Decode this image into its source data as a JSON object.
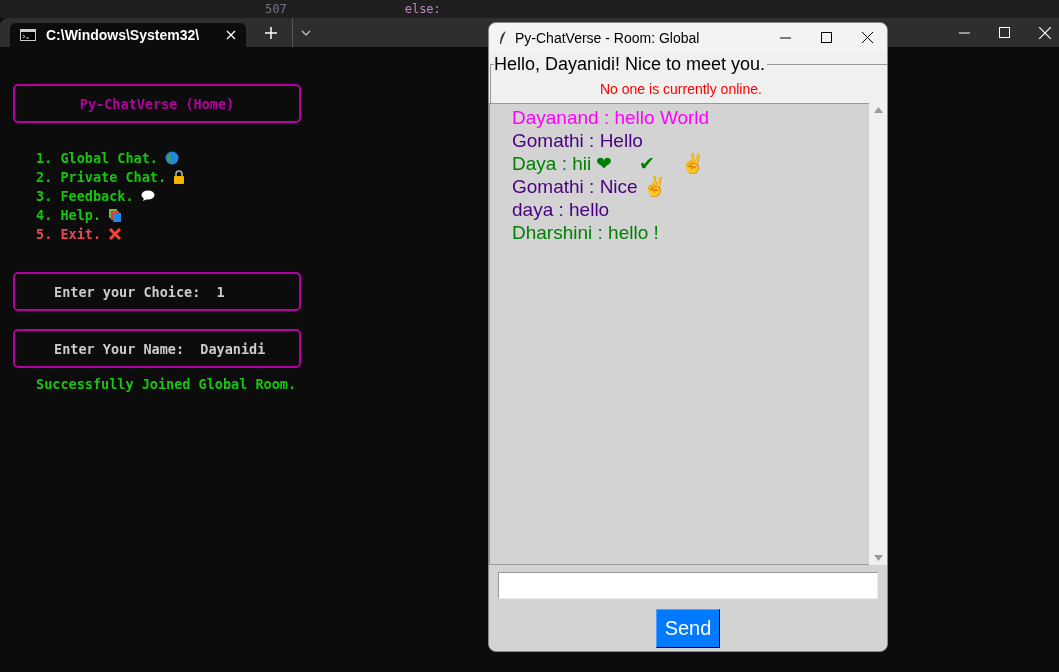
{
  "background_editor": {
    "line_number": "507",
    "code": "else:"
  },
  "terminal": {
    "tab_title": "C:\\Windows\\System32\\",
    "header": "Py-ChatVerse (Home)",
    "menu": [
      {
        "label": "1. Global Chat.",
        "kind": "globe",
        "color": "#16c60c"
      },
      {
        "label": "2. Private Chat.",
        "kind": "lock",
        "color": "#16c60c"
      },
      {
        "label": "3. Feedback.",
        "kind": "bubble",
        "color": "#16c60c"
      },
      {
        "label": "4. Help.",
        "kind": "books",
        "color": "#16c60c"
      },
      {
        "label": "5. Exit.",
        "kind": "cross",
        "color": "#e74856"
      }
    ],
    "prompts": [
      {
        "label": "Enter your Choice:",
        "value": "1"
      },
      {
        "label": "Enter Your Name:",
        "value": "Dayanidi"
      }
    ],
    "status": "Successfully Joined Global Room."
  },
  "chat_window": {
    "title": "Py-ChatVerse - Room: Global",
    "greeting": "Hello, Dayanidi! Nice to meet you.",
    "online_status": "No one is currently online.",
    "messages": [
      {
        "text": "Dayanand : hello World",
        "color": "#ff00ff"
      },
      {
        "text": "Gomathi : Hello",
        "color": "#4b0082"
      },
      {
        "text": "Daya : hii ❤     ✔     ✌",
        "color": "#008000"
      },
      {
        "text": "Gomathi : Nice ✌",
        "color": "#4b0082"
      },
      {
        "text": "daya : hello",
        "color": "#4b0082"
      },
      {
        "text": "Dharshini : hello !",
        "color": "#008000"
      }
    ],
    "send_button": "Send"
  }
}
